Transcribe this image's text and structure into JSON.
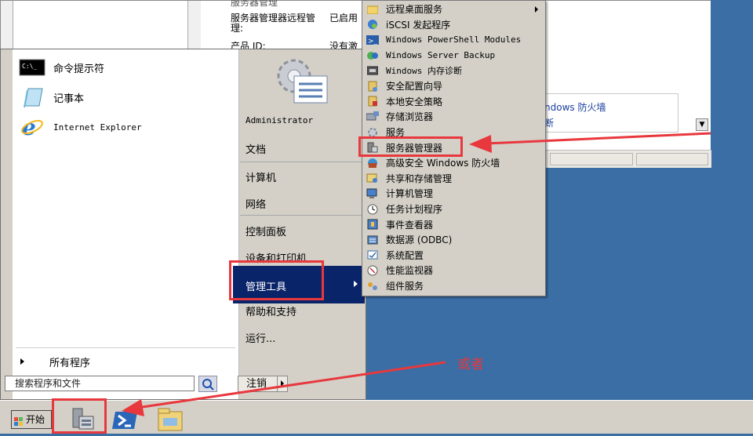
{
  "background_window": {
    "partial_top_text": "服务器管理",
    "remote_mgmt_label": "服务器管理器远程管理:",
    "remote_mgmt_value": "已启用",
    "ip_label": "产品 ID:",
    "ip_value": "没有激",
    "firewall_link": "ndows 防火墙",
    "link2": "断",
    "scroll_down": "▼"
  },
  "start_menu": {
    "pinned": [
      {
        "label": "命令提示符",
        "icon": "cmd-icon"
      },
      {
        "label": "记事本",
        "icon": "notepad-icon"
      },
      {
        "label": "Internet Explorer",
        "icon": "ie-icon"
      }
    ],
    "all_programs": "所有程序",
    "search_placeholder": "搜索程序和文件",
    "right_items": {
      "admin": "Administrator",
      "docs": "文档",
      "computer": "计算机",
      "network": "网络",
      "control_panel": "控制面板",
      "devices": "设备和打印机",
      "admin_tools": "管理工具",
      "help": "帮助和支持",
      "run": "运行..."
    },
    "logoff": "注销"
  },
  "submenu": {
    "items": [
      {
        "label": "远程桌面服务",
        "has_sub": true
      },
      {
        "label": "iSCSI 发起程序"
      },
      {
        "label": "Windows PowerShell Modules"
      },
      {
        "label": "Windows Server Backup"
      },
      {
        "label": "Windows 内存诊断"
      },
      {
        "label": "安全配置向导"
      },
      {
        "label": "本地安全策略"
      },
      {
        "label": "存储浏览器"
      },
      {
        "label": "服务"
      },
      {
        "label": "服务器管理器"
      },
      {
        "label": "高级安全 Windows 防火墙"
      },
      {
        "label": "共享和存储管理"
      },
      {
        "label": "计算机管理"
      },
      {
        "label": "任务计划程序"
      },
      {
        "label": "事件查看器"
      },
      {
        "label": "数据源 (ODBC)"
      },
      {
        "label": "系统配置"
      },
      {
        "label": "性能监视器"
      },
      {
        "label": "组件服务"
      }
    ]
  },
  "annotation": {
    "or_label": "或者",
    "color": "#e8383d"
  },
  "taskbar": {
    "start_label": "开始"
  }
}
